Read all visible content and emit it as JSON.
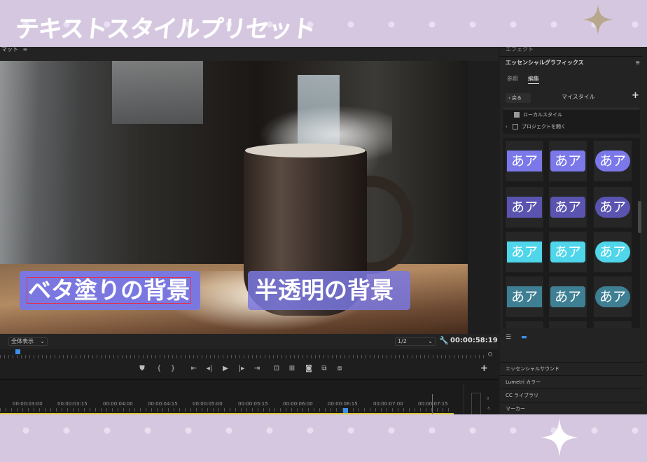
{
  "banner": {
    "title": "テキストスタイルプリセット"
  },
  "program_monitor": {
    "header_title": "マット",
    "captions": {
      "opaque": "ベタ塗りの背景",
      "translucent": "半透明の背景"
    },
    "zoom_select": "全体表示",
    "resolution_select": "1/2",
    "timecode": "00:00:58:19"
  },
  "timeline": {
    "ruler_labels": [
      "00:00:03:00",
      "00:00:03:15",
      "00:00:04:00",
      "00:00:04:15",
      "00:00:05:00",
      "00:00:05:15",
      "00:00:06:00",
      "00:00:06:15",
      "00:00:07:00",
      "00:00:07:15"
    ],
    "meter_labels": [
      "0",
      "-5"
    ]
  },
  "panel": {
    "effects_label": "エフェクト",
    "title": "エッセンシャルグラフィックス",
    "tabs": [
      "参照",
      "編集"
    ],
    "active_tab": "編集",
    "back_label": "戻る",
    "style_library_title": "マイスタイル",
    "folders": [
      {
        "label": "ローカルスタイル",
        "checked": true
      },
      {
        "label": "プロジェクトを開く",
        "checked": false
      }
    ],
    "preset_glyph": "あア",
    "preset_colors": [
      "#7b78ea",
      "#5a54b0",
      "#4fd6ea",
      "#3f7f93"
    ],
    "lower_panels": [
      "エッセンシャルサウンド",
      "Lumetri カラー",
      "CC ライブラリ",
      "マーカー"
    ]
  }
}
